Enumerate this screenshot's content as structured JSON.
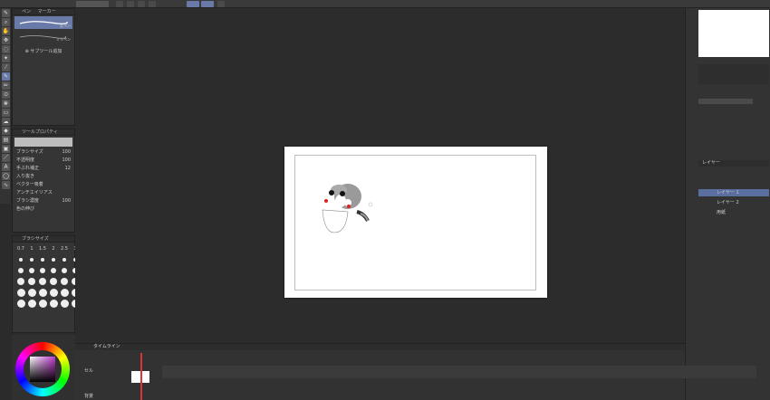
{
  "subtool": {
    "tabs": [
      "ペン",
      "マーカー"
    ],
    "brush_label": "丸ペン",
    "brush_label2": "ミリペン",
    "add_label": "サブツール追加"
  },
  "properties": {
    "header": "ツールプロパティ",
    "items": [
      {
        "label": "ブラシサイズ",
        "value": "100"
      },
      {
        "label": "不透明度",
        "value": "100"
      },
      {
        "label": "手ぶれ補正",
        "value": "12"
      },
      {
        "label": "入り抜き",
        "value": ""
      },
      {
        "label": "ベクター吸着",
        "value": ""
      },
      {
        "label": "アンチエイリアス",
        "value": ""
      },
      {
        "label": "ブラシ濃度",
        "value": "100"
      },
      {
        "label": "色の伸び",
        "value": ""
      }
    ]
  },
  "brushsize": {
    "header": "ブラシサイズ",
    "top_labels": [
      "0.7",
      "1",
      "1.5",
      "2",
      "2.5",
      "3"
    ]
  },
  "timeline": {
    "header": "タイムライン",
    "track1": "セル",
    "track2": "背景"
  },
  "right": {
    "layer_header": "レイヤー",
    "layers": [
      "レイヤー 1",
      "レイヤー 2",
      "用紙"
    ]
  },
  "colors": {
    "accent": "#6a7aa8",
    "canvas_bg": "#2c2c2c"
  }
}
